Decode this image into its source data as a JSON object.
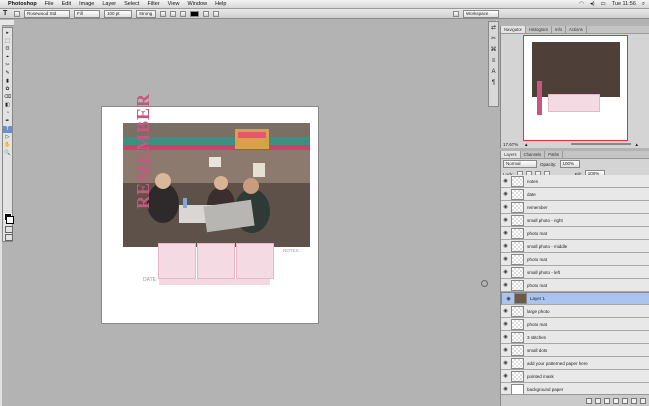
{
  "menubar": {
    "app": "Photoshop",
    "items": [
      "File",
      "Edit",
      "Image",
      "Layer",
      "Select",
      "Filter",
      "View",
      "Window",
      "Help"
    ],
    "clock": "Tue 11:56"
  },
  "options": {
    "tool_glyph": "T",
    "font_family": "Rosewood Std",
    "font_style": "Fill",
    "size": "100 pt",
    "aa": "Strong",
    "workspace": "Workspace"
  },
  "tools": [
    "▸",
    "⬚",
    "ʘ",
    "⌖",
    "✂",
    "✎",
    "▮",
    "✿",
    "⌫",
    "◧",
    "◔",
    "✒",
    "T",
    "▷",
    "✋",
    "🔍"
  ],
  "dock_icons": [
    "⇄",
    "✂",
    "⌘",
    "≡",
    "A",
    "¶"
  ],
  "navigator": {
    "tabs": [
      "Navigator",
      "Histogram",
      "Info",
      "Actions"
    ],
    "zoom": "17.67%"
  },
  "layers": {
    "tabs": [
      "Layers",
      "Channels",
      "Paths"
    ],
    "blend_mode": "Normal",
    "opacity_label": "Opacity:",
    "opacity": "100%",
    "lock_label": "Lock:",
    "fill_label": "Fill:",
    "fill": "100%",
    "items": [
      {
        "name": "notes",
        "thumb": "checker",
        "selected": false
      },
      {
        "name": "date",
        "thumb": "checker",
        "selected": false
      },
      {
        "name": "remember",
        "thumb": "checker",
        "selected": false
      },
      {
        "name": "small photo - right",
        "thumb": "checker",
        "selected": false
      },
      {
        "name": "photo mat",
        "thumb": "checker",
        "selected": false
      },
      {
        "name": "small photo - middle",
        "thumb": "checker",
        "selected": false
      },
      {
        "name": "photo mat",
        "thumb": "checker",
        "selected": false
      },
      {
        "name": "small photo - left",
        "thumb": "checker",
        "selected": false
      },
      {
        "name": "photo mat",
        "thumb": "checker",
        "selected": false
      },
      {
        "name": "Layer 1",
        "thumb": "photo",
        "selected": true
      },
      {
        "name": "large photo",
        "thumb": "checker",
        "selected": false
      },
      {
        "name": "photo mat",
        "thumb": "checker",
        "selected": false
      },
      {
        "name": "3 stitches",
        "thumb": "checker",
        "selected": false
      },
      {
        "name": "small dots",
        "thumb": "checker",
        "selected": false
      },
      {
        "name": "add your patterned paper here",
        "thumb": "checker",
        "selected": false
      },
      {
        "name": "pointed mask",
        "thumb": "checker",
        "selected": false
      },
      {
        "name": "background paper",
        "thumb": "plain",
        "selected": false
      }
    ]
  },
  "canvas": {
    "vertical_word": "REMEMBER",
    "date_label": "DATE:",
    "notes_label": "NOTES:"
  },
  "colors": {
    "accent_pink": "#c8577f",
    "mat_pink": "#f4dbe3",
    "selection_blue": "#a9c4ee"
  }
}
